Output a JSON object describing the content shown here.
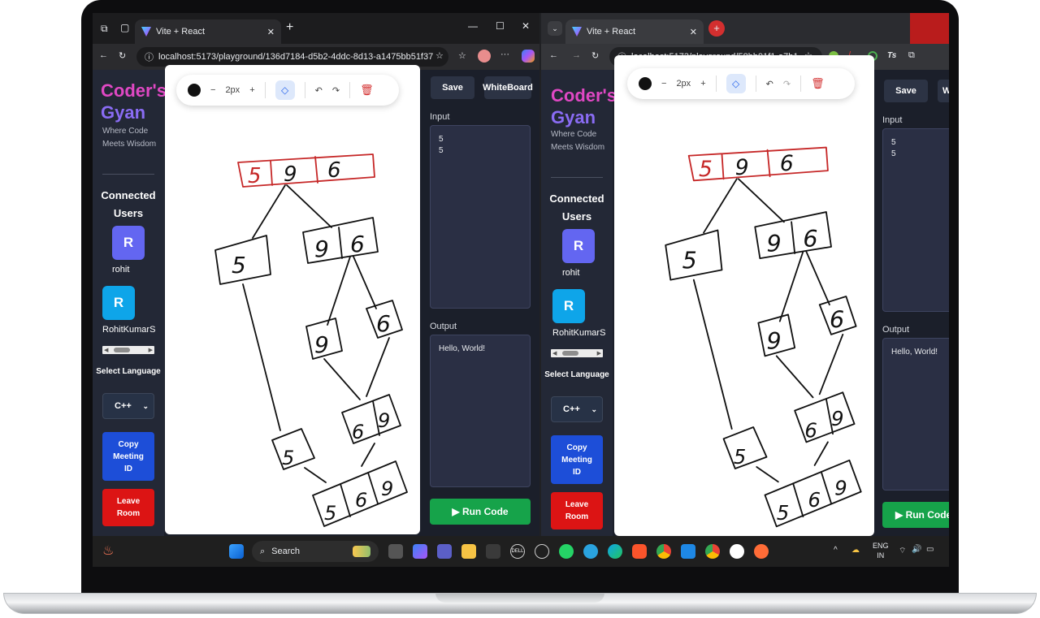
{
  "left_window": {
    "tab_title": "Vite + React",
    "url": "localhost:5173/playground/136d7184-d5b2-4ddc-8d13-a1475bb51f37"
  },
  "right_window": {
    "tab_title": "Vite + React",
    "url": "localhost:5173/playground/58bb91f1-a7b1-..."
  },
  "app": {
    "logo_line1": "Coder's",
    "logo_line2": "Gyan",
    "tagline": "Where Code Meets Wisdom",
    "connected_users_label": "Connected Users",
    "users": [
      {
        "initial": "R",
        "name": "rohit",
        "color": "#6366f1"
      },
      {
        "initial": "R",
        "name": "RohitKumarS",
        "color": "#0ea5e9"
      }
    ],
    "select_language_label": "Select Language",
    "language": "C++",
    "copy_meeting_id": "Copy Meeting ID",
    "leave_room": "Leave Room",
    "toolbar": {
      "stroke_size": "2px",
      "minus": "−",
      "plus": "+"
    },
    "save_label": "Save",
    "whiteboard_label": "WhiteBoard",
    "input_label": "Input",
    "input_value": "5\n5",
    "output_label": "Output",
    "output_value": "Hello, World!",
    "run_code_label": "▶ Run Code",
    "drawing_digits": [
      "5",
      "9",
      "6"
    ]
  },
  "taskbar": {
    "search_placeholder": "Search",
    "lang_line1": "ENG",
    "lang_line2": "IN"
  },
  "colors": {
    "accent_pink": "#e048c4",
    "accent_purple": "#8a6cf4",
    "copy_button": "#1d4ed8",
    "leave_button": "#dc1414",
    "run_button": "#16a34a"
  }
}
